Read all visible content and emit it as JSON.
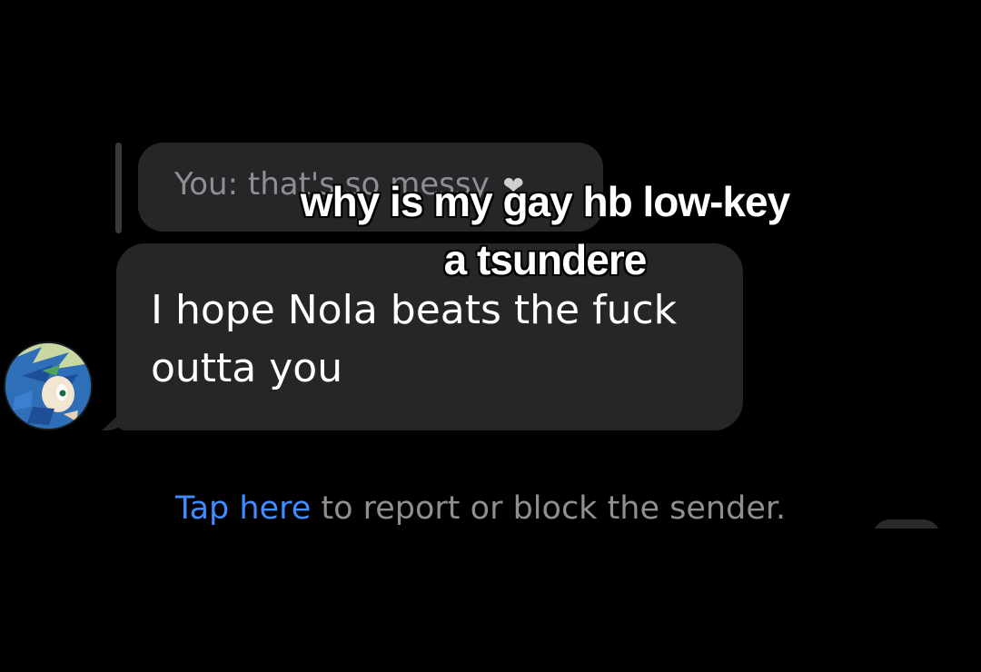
{
  "conversation": {
    "quoted_reply": {
      "prefix": "You:",
      "text": "that's so messy",
      "emoji": "❤"
    },
    "message": {
      "line1": "I hope Nola beats the fuck",
      "line2": "outta you"
    },
    "avatar": {
      "icon": "sonic-avatar-icon"
    },
    "report": {
      "link_text": "Tap here",
      "rest_text": " to report or block the sender."
    }
  },
  "overlay_caption": {
    "line1": "why is my gay hb low-key",
    "line2": "a tsundere"
  },
  "colors": {
    "background": "#000000",
    "bubble": "#262628",
    "link": "#3f8cff",
    "muted_text": "#8e8e93"
  }
}
